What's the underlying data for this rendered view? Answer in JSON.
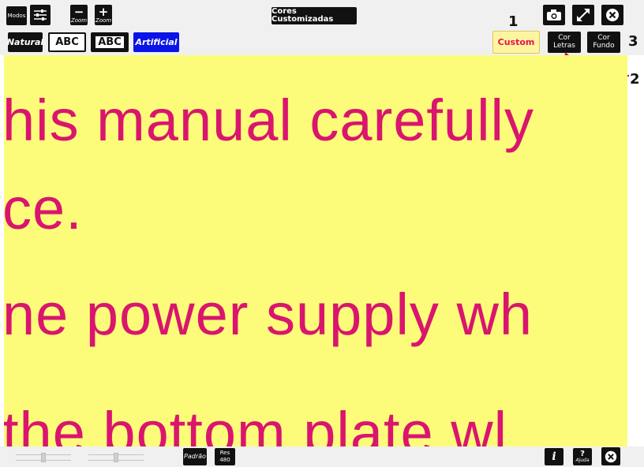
{
  "toolbar": {
    "modos": "Modos",
    "zoom_out_symbol": "−",
    "zoom_in_symbol": "+",
    "zoom_label": "Zoom",
    "title": "Cores Customizadas"
  },
  "color_modes": {
    "natural": "Natural",
    "abc_1": "ABC",
    "abc_2": "ABC",
    "artificial": "Artificial",
    "custom": "Custom"
  },
  "color_buttons": {
    "cor_letras_line1": "Cor",
    "cor_letras_line2": "Letras",
    "cor_fundo_line1": "Cor",
    "cor_fundo_line2": "Fundo"
  },
  "annotations": {
    "n1": "1",
    "n2": "2",
    "n3": "3"
  },
  "viewer": {
    "line1": "his manual carefully",
    "line2": "ce.",
    "line3": "ne power supply wh",
    "line4": "the bottom plate wl"
  },
  "bottom": {
    "padrao": "Padrão",
    "res_label": "Res",
    "res_value": "480",
    "info_symbol": "i",
    "help_symbol": "?",
    "help_label": "Ajuda"
  },
  "colors": {
    "background": "#fcfc7a",
    "text": "#d9156e",
    "artificial_button": "#0a14e6",
    "custom_button_bg": "#fdf5a0",
    "custom_button_text": "#e8124a",
    "annotation_arrow": "#c4103a"
  },
  "icons": [
    "sliders-icon",
    "camera-icon",
    "fullscreen-icon",
    "close-icon",
    "info-icon",
    "help-icon"
  ]
}
